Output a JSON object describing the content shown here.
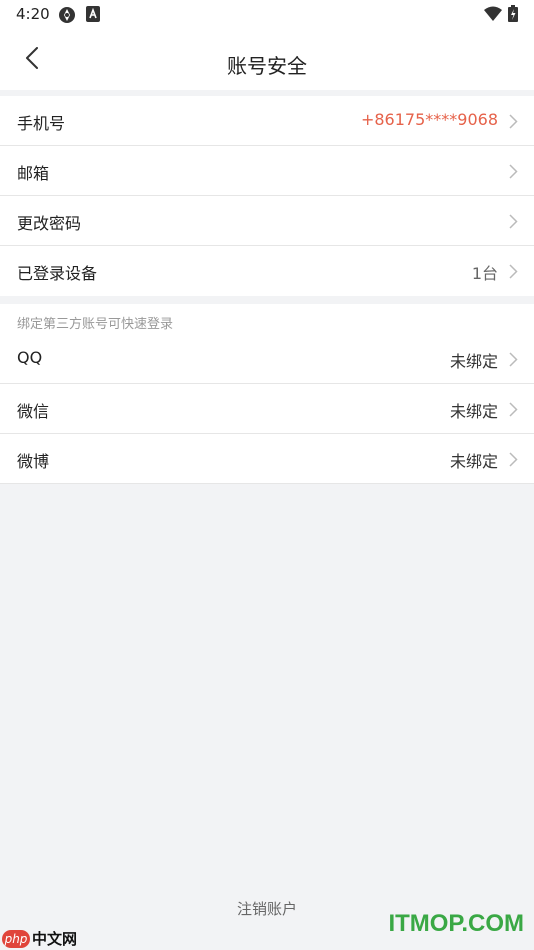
{
  "status_bar": {
    "time": "4:20"
  },
  "nav": {
    "title": "账号安全"
  },
  "account_rows": [
    {
      "label": "手机号",
      "value": "+86175****9068"
    },
    {
      "label": "邮箱",
      "value": ""
    },
    {
      "label": "更改密码",
      "value": ""
    },
    {
      "label": "已登录设备",
      "value": "1台"
    }
  ],
  "third_party": {
    "caption": "绑定第三方账号可快速登录",
    "rows": [
      {
        "label": "QQ",
        "value": "未绑定"
      },
      {
        "label": "微信",
        "value": "未绑定"
      },
      {
        "label": "微博",
        "value": "未绑定"
      }
    ]
  },
  "footer": {
    "delete_account": "注销账户"
  },
  "watermarks": {
    "left_badge": "php",
    "left_text": "中文网",
    "right_text": "ITMOP.COM"
  },
  "colors": {
    "accent_phone": "#e6624a",
    "watermark_green": "#3aa845",
    "background": "#f2f3f5"
  },
  "icons": {
    "back": "back-arrow-icon",
    "row_chevron": "chevron-right-icon"
  }
}
